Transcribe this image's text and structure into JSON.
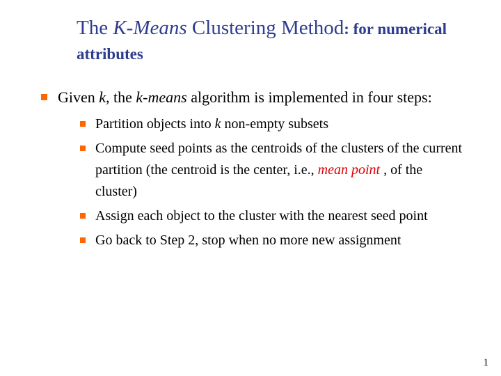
{
  "title": {
    "pre": "The ",
    "kmeans": "K-Means",
    "mid": " Clustering Method",
    "sub": ": for numerical attributes"
  },
  "outer": {
    "pre": "Given ",
    "k": "k",
    "mid": ", the ",
    "km": "k-means",
    "post": " algorithm is implemented in four steps:"
  },
  "inner": {
    "i1pre": "Partition objects into ",
    "i1k": "k",
    "i1post": " non-empty subsets",
    "i2pre": "Compute seed points as the centroids of the clusters of the current partition (the centroid is the center, i.e., ",
    "i2accent": "mean point",
    "i2post": " , of the cluster)",
    "i3": "Assign each object to the cluster with the nearest seed point",
    "i4": "Go back to Step 2, stop when no more new assignment"
  },
  "pagenum": "1"
}
